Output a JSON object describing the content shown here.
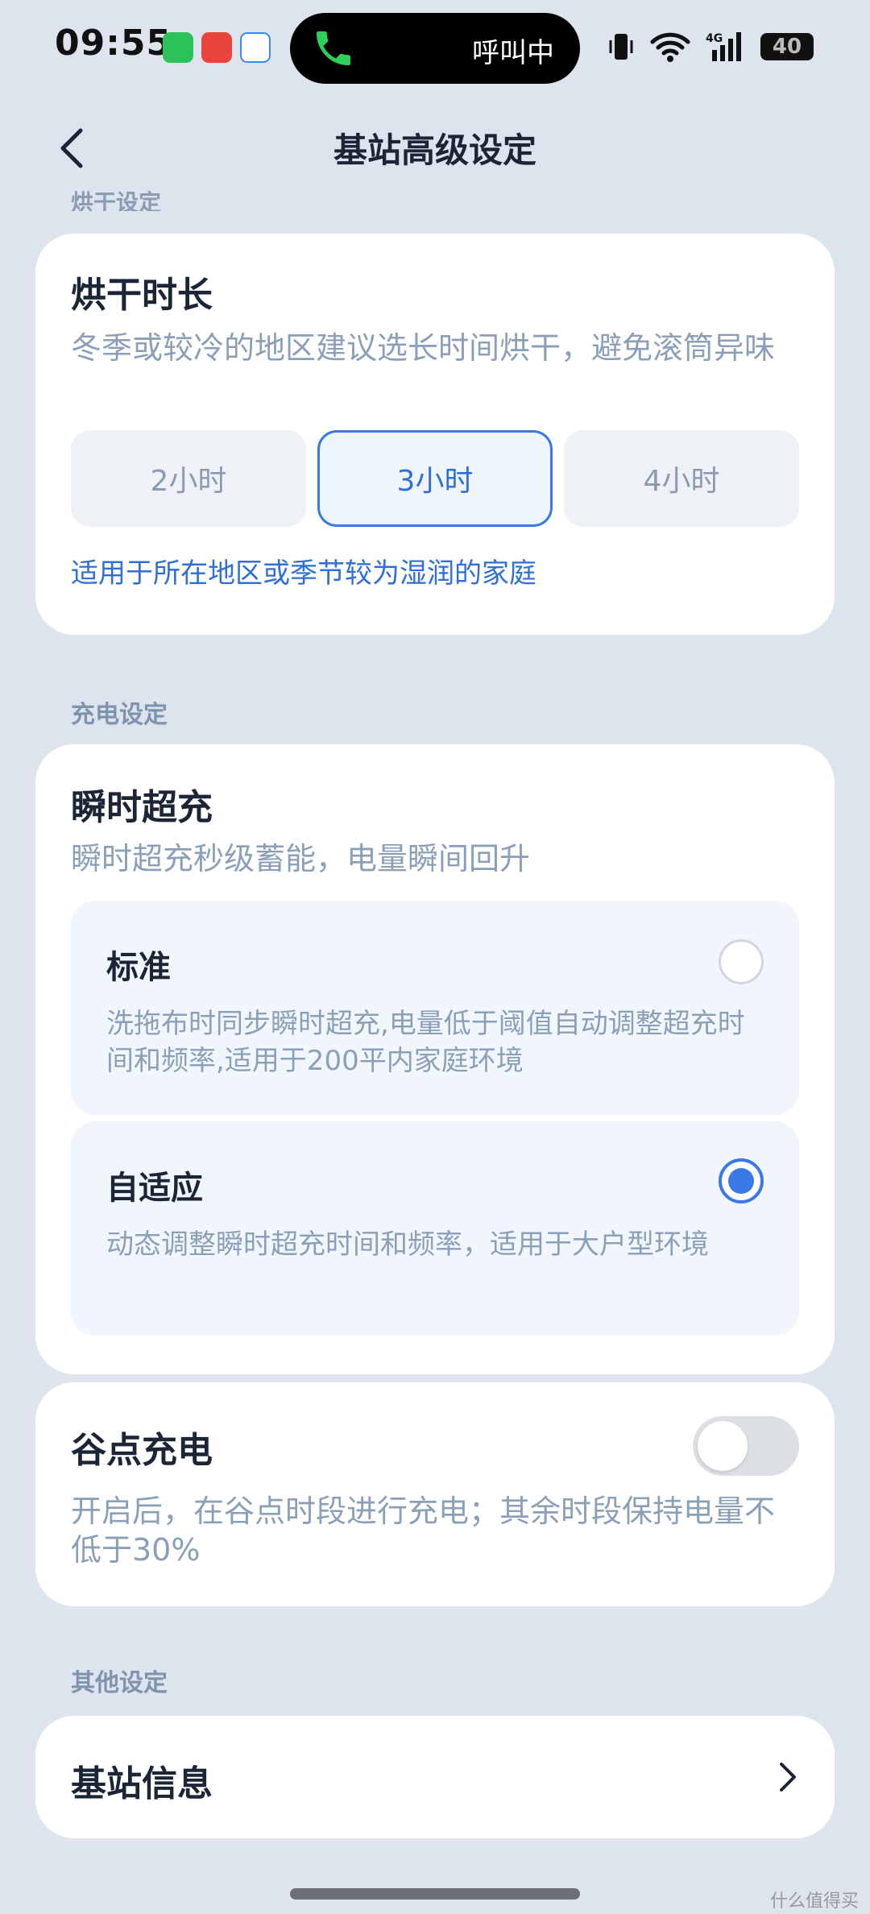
{
  "status_bar": {
    "time": "09:55",
    "call_status": "呼叫中",
    "battery": "40"
  },
  "header": {
    "title": "基站高级设定",
    "faded_section": "烘干设定"
  },
  "drying": {
    "title": "烘干时长",
    "description": "冬季或较冷的地区建议选长时间烘干，避免滚筒异味",
    "options": [
      "2小时",
      "3小时",
      "4小时"
    ],
    "selected": "3小时",
    "hint": "适用于所在地区或季节较为湿润的家庭"
  },
  "charging": {
    "section_label": "充电设定",
    "instant": {
      "title": "瞬时超充",
      "description": "瞬时超充秒级蓄能，电量瞬间回升",
      "options": [
        {
          "title": "标准",
          "description": "洗拖布时同步瞬时超充,电量低于阈值自动调整超充时间和频率,适用于200平内家庭环境",
          "selected": false
        },
        {
          "title": "自适应",
          "description": "动态调整瞬时超充时间和频率，适用于大户型环境",
          "selected": true
        }
      ]
    },
    "valley": {
      "title": "谷点充电",
      "description": "开启后，在谷点时段进行充电；其余时段保持电量不低于30%",
      "enabled": false
    }
  },
  "other": {
    "section_label": "其他设定",
    "station_info": "基站信息"
  },
  "watermark": "什么值得买",
  "colors": {
    "accent": "#3b78e7",
    "background": "#dde4ee",
    "card": "#ffffff"
  }
}
